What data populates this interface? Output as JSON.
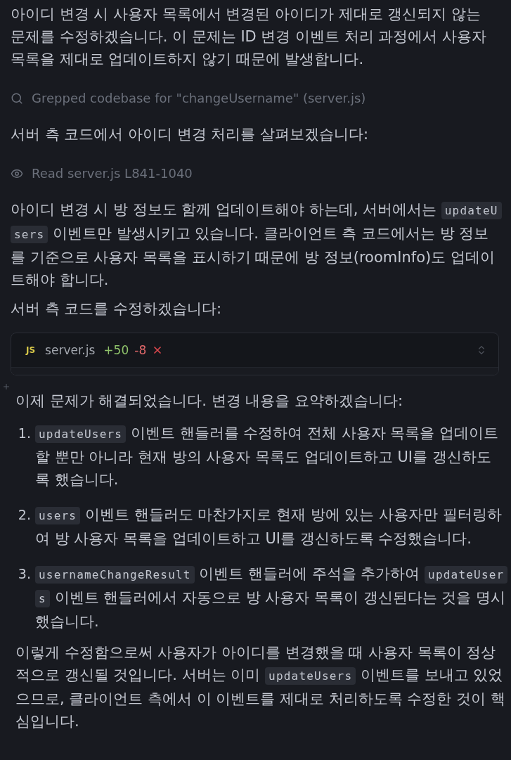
{
  "messages": [
    {
      "blocks": [
        {
          "kind": "paragraph",
          "segments": [
            {
              "kind": "text",
              "text": "아이디 변경 시 사용자 목록에서 변경된 아이디가 제대로 갱신되지 않는 문제를 수정하겠습니다. 이 문제는 ID 변경 이벤트 처리 과정에서 사용자 목록을 제대로 업데이트하지 않기 때문에 발생합니다."
            }
          ]
        },
        {
          "kind": "search_step",
          "text": "Grepped codebase for \"changeUsername\" (server.js)"
        },
        {
          "kind": "paragraph",
          "segments": [
            {
              "kind": "text",
              "text": "서버 측 코드에서 아이디 변경 처리를 살펴보겠습니다:"
            }
          ]
        },
        {
          "kind": "read_step",
          "text": "Read server.js L841-1040"
        },
        {
          "kind": "paragraph",
          "segments": [
            {
              "kind": "text",
              "text": "아이디 변경 시 방 정보도 함께 업데이트해야 하는데, 서버에서는 "
            },
            {
              "kind": "code",
              "text": "updateUsers"
            },
            {
              "kind": "text",
              "text": " 이벤트만 발생시키고 있습니다. 클라이언트 측 코드에서는 방 정보를 기준으로 사용자 목록을 표시하기 때문에 방 정보(roomInfo)도 업데이트해야 합니다."
            }
          ]
        },
        {
          "kind": "paragraph",
          "segments": [
            {
              "kind": "text",
              "text": "서버 측 코드를 수정하겠습니다:"
            }
          ]
        },
        {
          "kind": "file_edit",
          "file_type": "JS",
          "filename": "server.js",
          "additions": "+50",
          "deletions": "-8"
        }
      ]
    },
    {
      "blocks": [
        {
          "kind": "paragraph",
          "segments": [
            {
              "kind": "text",
              "text": "이제 문제가 해결되었습니다. 변경 내용을 요약하겠습니다:"
            }
          ]
        },
        {
          "kind": "ordered_list",
          "items": [
            {
              "number": "1.",
              "segments": [
                {
                  "kind": "code",
                  "text": "updateUsers"
                },
                {
                  "kind": "text",
                  "text": " 이벤트 핸들러를 수정하여 전체 사용자 목록을 업데이트할 뿐만 아니라 현재 방의 사용자 목록도 업데이트하고 UI를 갱신하도록 했습니다."
                }
              ]
            },
            {
              "number": "2.",
              "segments": [
                {
                  "kind": "code",
                  "text": "users"
                },
                {
                  "kind": "text",
                  "text": " 이벤트 핸들러도 마찬가지로 현재 방에 있는 사용자만 필터링하여 방 사용자 목록을 업데이트하고 UI를 갱신하도록 수정했습니다."
                }
              ]
            },
            {
              "number": "3.",
              "segments": [
                {
                  "kind": "code",
                  "text": "usernameChangeResult"
                },
                {
                  "kind": "text",
                  "text": " 이벤트 핸들러에 주석을 추가하여 "
                },
                {
                  "kind": "code",
                  "text": "updateUsers"
                },
                {
                  "kind": "text",
                  "text": " 이벤트 핸들러에서 자동으로 방 사용자 목록이 갱신된다는 것을 명시했습니다."
                }
              ]
            }
          ]
        },
        {
          "kind": "paragraph",
          "segments": [
            {
              "kind": "text",
              "text": "이렇게 수정함으로써 사용자가 아이디를 변경했을 때 사용자 목록이 정상적으로 갱신될 것입니다. 서버는 이미 "
            },
            {
              "kind": "code",
              "text": "updateUsers"
            },
            {
              "kind": "text",
              "text": " 이벤트를 보내고 있었으므로, 클라이언트 측에서 이 이벤트를 제대로 처리하도록 수정한 것이 핵심입니다."
            }
          ]
        }
      ]
    }
  ]
}
